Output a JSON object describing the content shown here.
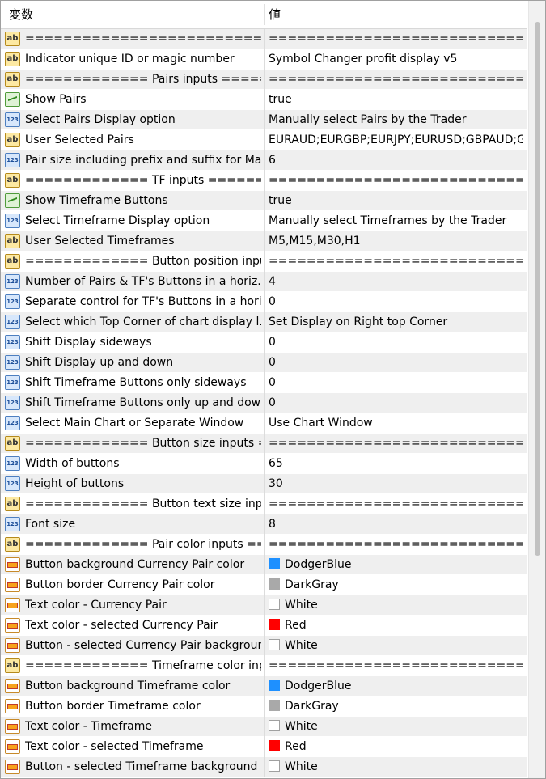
{
  "header": {
    "name": "変数",
    "value": "値"
  },
  "rows": [
    {
      "type": "ab",
      "name": "==============================...",
      "value": "================================..."
    },
    {
      "type": "ab",
      "name": "Indicator unique ID or magic number",
      "value": "Symbol Changer profit display v5"
    },
    {
      "type": "ab",
      "name": "============= Pairs inputs ======...",
      "value": "================================..."
    },
    {
      "type": "bool",
      "name": "Show Pairs",
      "value": "true"
    },
    {
      "type": "num",
      "name": "Select Pairs Display option",
      "value": "Manually select Pairs by the Trader"
    },
    {
      "type": "ab",
      "name": "User Selected Pairs",
      "value": "EURAUD;EURGBP;EURJPY;EURUSD;GBPAUD;GB..."
    },
    {
      "type": "num",
      "name": "Pair size including prefix and suffix for Ma...",
      "value": "6"
    },
    {
      "type": "ab",
      "name": "============= TF inputs ========...",
      "value": "================================..."
    },
    {
      "type": "bool",
      "name": "Show Timeframe Buttons",
      "value": "true"
    },
    {
      "type": "num",
      "name": "Select Timeframe Display option",
      "value": "Manually select Timeframes by the Trader"
    },
    {
      "type": "ab",
      "name": "User Selected Timeframes",
      "value": "M5,M15,M30,H1"
    },
    {
      "type": "ab",
      "name": "============= Button position inputs...",
      "value": "================================..."
    },
    {
      "type": "num",
      "name": "Number of Pairs & TF's Buttons in a horiz...",
      "value": "4"
    },
    {
      "type": "num",
      "name": "Separate control for TF's Buttons in a hori...",
      "value": "0"
    },
    {
      "type": "num",
      "name": "Select which Top Corner of chart display l...",
      "value": "Set Display on Right top Corner"
    },
    {
      "type": "num",
      "name": "Shift Display sideways",
      "value": "0"
    },
    {
      "type": "num",
      "name": "Shift Display up and down",
      "value": "0"
    },
    {
      "type": "num",
      "name": "Shift Timeframe Buttons only sideways",
      "value": "0"
    },
    {
      "type": "num",
      "name": "Shift Timeframe Buttons only up and down",
      "value": "0"
    },
    {
      "type": "num",
      "name": "Select Main Chart or Separate Window",
      "value": "Use Chart Window"
    },
    {
      "type": "ab",
      "name": "============= Button size inputs ==...",
      "value": "================================..."
    },
    {
      "type": "num",
      "name": "Width of buttons",
      "value": "65"
    },
    {
      "type": "num",
      "name": "Height of buttons",
      "value": "30"
    },
    {
      "type": "ab",
      "name": "============= Button text size input...",
      "value": "================================..."
    },
    {
      "type": "num",
      "name": "Font size",
      "value": "8"
    },
    {
      "type": "ab",
      "name": "============= Pair color inputs ===...",
      "value": "================================..."
    },
    {
      "type": "color",
      "name": "Button background Currency Pair color",
      "value": "DodgerBlue",
      "swatch": "#1e90ff"
    },
    {
      "type": "color",
      "name": "Button border Currency Pair color",
      "value": "DarkGray",
      "swatch": "#a9a9a9"
    },
    {
      "type": "color",
      "name": "Text color -  Currency Pair",
      "value": "White",
      "swatch": "#ffffff"
    },
    {
      "type": "color",
      "name": "Text color - selected Currency Pair",
      "value": "Red",
      "swatch": "#ff0000"
    },
    {
      "type": "color",
      "name": "Button - selected Currency Pair backgroun...",
      "value": "White",
      "swatch": "#ffffff"
    },
    {
      "type": "ab",
      "name": "============= Timeframe color input...",
      "value": "================================..."
    },
    {
      "type": "color",
      "name": "Button background Timeframe color",
      "value": "DodgerBlue",
      "swatch": "#1e90ff"
    },
    {
      "type": "color",
      "name": "Button border Timeframe color",
      "value": "DarkGray",
      "swatch": "#a9a9a9"
    },
    {
      "type": "color",
      "name": "Text color -  Timeframe",
      "value": "White",
      "swatch": "#ffffff"
    },
    {
      "type": "color",
      "name": "Text color - selected Timeframe",
      "value": "Red",
      "swatch": "#ff0000"
    },
    {
      "type": "color",
      "name": "Button - selected Timeframe background ...",
      "value": "White",
      "swatch": "#ffffff"
    }
  ]
}
